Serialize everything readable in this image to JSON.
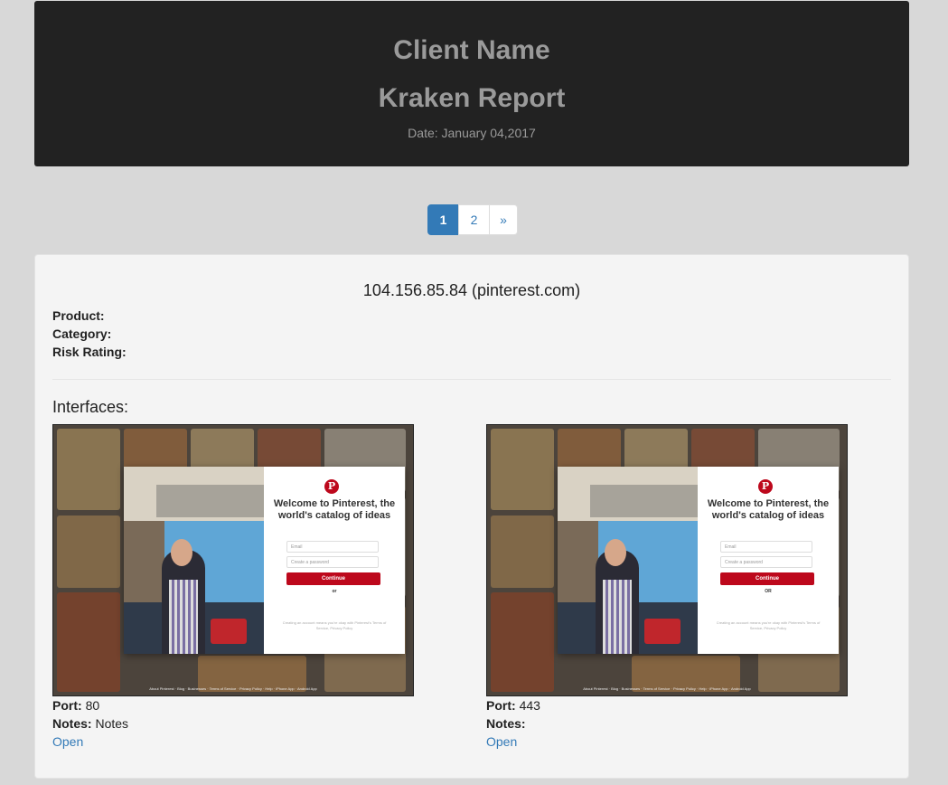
{
  "header": {
    "client_name": "Client Name",
    "report_title": "Kraken Report",
    "date": "Date: January 04,2017"
  },
  "pagination": {
    "pages": [
      "1",
      "2"
    ],
    "next_label": "»",
    "active_page": "1"
  },
  "host": {
    "title": "104.156.85.84 (pinterest.com)",
    "product_label": "Product:",
    "category_label": "Category:",
    "risk_label": "Risk Rating:",
    "interfaces_label": "Interfaces:"
  },
  "interfaces": [
    {
      "port_label": "Port:",
      "port": "80",
      "notes_label": "Notes:",
      "notes": "Notes",
      "open_label": "Open",
      "screenshot": {
        "welcome": "Welcome to Pinterest, the world's catalog of ideas",
        "email_placeholder": "Email",
        "password_placeholder": "Create a password",
        "continue_label": "Continue",
        "or_label": "or",
        "legal": "Creating an account means you're okay with Pinterest's Terms of Service, Privacy Policy",
        "footer": "About Pinterest · Blog · Businesses · Terms of Service · Privacy Policy · Help · iPhone App · Android App"
      }
    },
    {
      "port_label": "Port:",
      "port": "443",
      "notes_label": "Notes:",
      "notes": "",
      "open_label": "Open",
      "screenshot": {
        "welcome": "Welcome to Pinterest, the world's catalog of ideas",
        "email_placeholder": "Email",
        "password_placeholder": "Create a password",
        "continue_label": "Continue",
        "or_label": "OR",
        "legal": "Creating an account means you're okay with Pinterest's Terms of Service, Privacy Policy",
        "footer": "About Pinterest · Blog · Businesses · Terms of Service · Privacy Policy · Help · iPhone App · Android App"
      }
    }
  ],
  "colors": {
    "page_bg": "#d8d8d8",
    "header_bg": "#222222",
    "link": "#337ab7",
    "pinterest_red": "#bd081c"
  }
}
